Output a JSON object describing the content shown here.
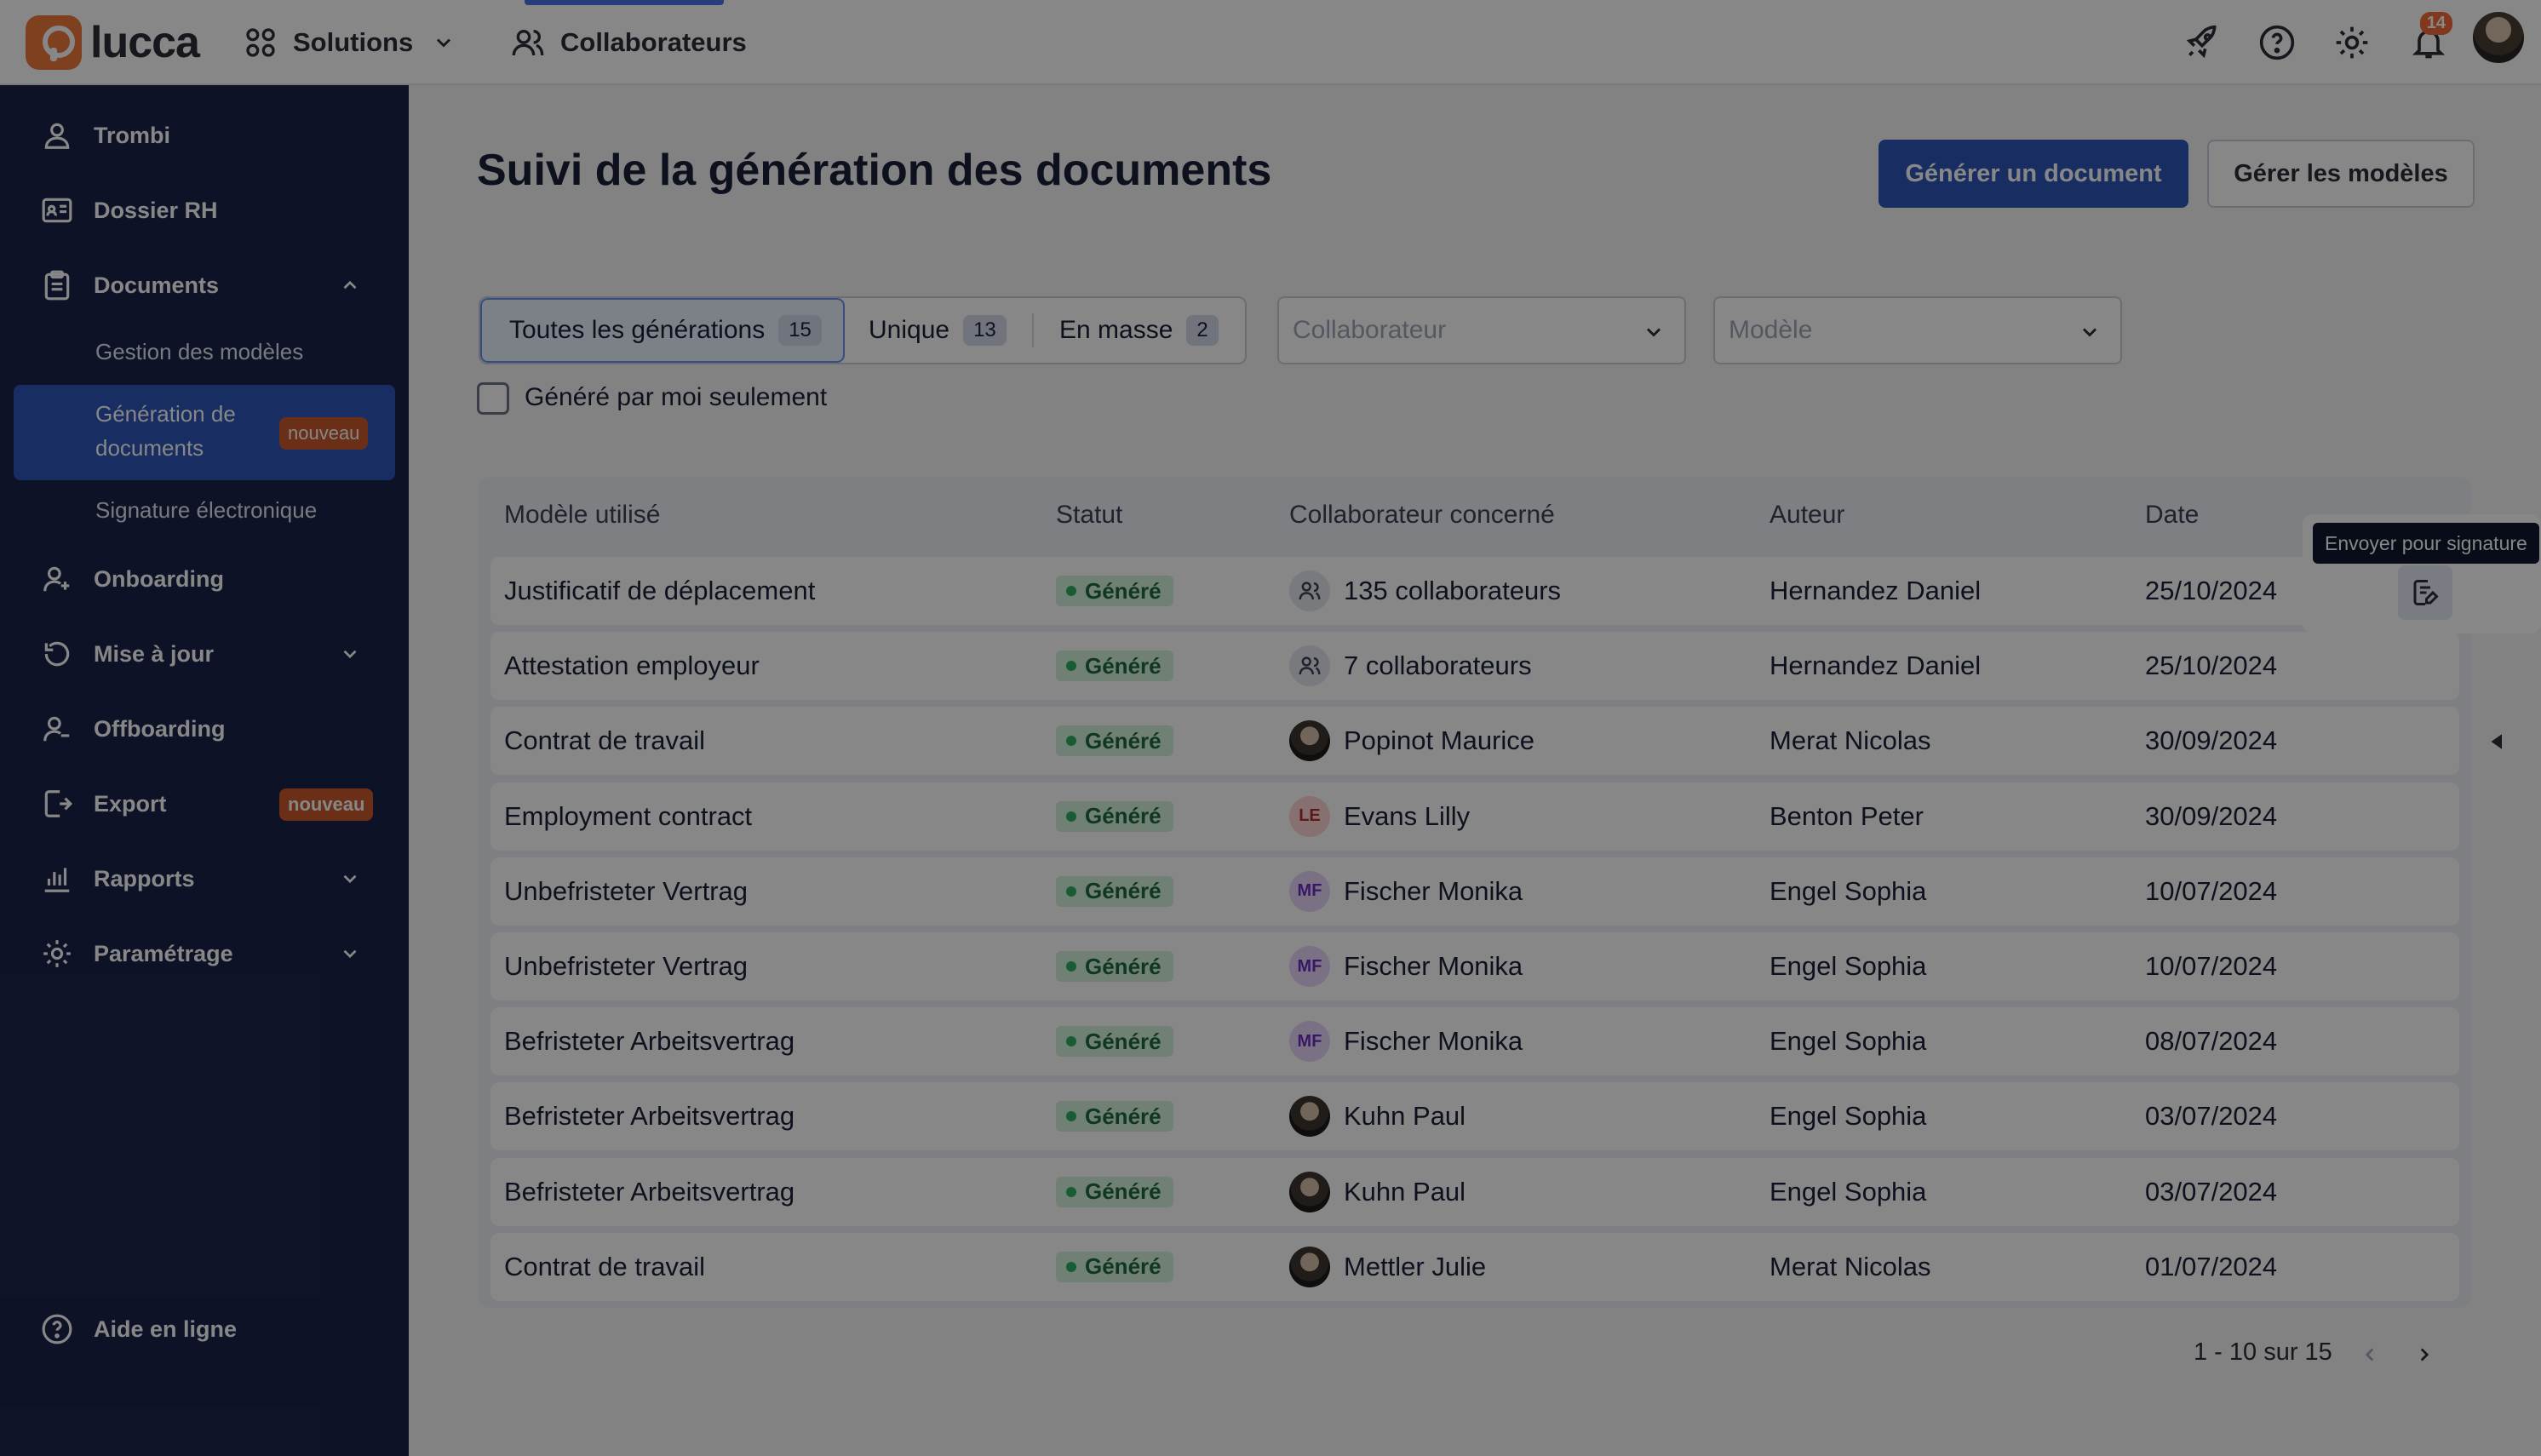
{
  "brand": {
    "name": "lucca",
    "accent": "#f07a3c",
    "primary": "#2f55b8",
    "sidebar_bg": "#1a2349"
  },
  "topbar": {
    "solutions_label": "Solutions",
    "collaborateurs_label": "Collaborateurs",
    "notifications_count": "14",
    "icons": [
      "rocket-icon",
      "help-icon",
      "gear-icon",
      "bell-icon"
    ]
  },
  "sidebar": {
    "items": [
      {
        "label": "Trombi",
        "icon": "person-icon"
      },
      {
        "label": "Dossier RH",
        "icon": "id-card-icon"
      },
      {
        "label": "Documents",
        "icon": "clipboard-icon",
        "expanded": true
      },
      {
        "label": "Onboarding",
        "icon": "person-add-icon"
      },
      {
        "label": "Mise à jour",
        "icon": "refresh-icon"
      },
      {
        "label": "Offboarding",
        "icon": "person-remove-icon"
      },
      {
        "label": "Export",
        "icon": "export-icon",
        "badge": "nouveau"
      },
      {
        "label": "Rapports",
        "icon": "bar-chart-icon"
      },
      {
        "label": "Paramétrage",
        "icon": "gear-icon"
      }
    ],
    "documents_sub": [
      {
        "label": "Gestion des modèles"
      },
      {
        "label": "Génération de documents",
        "badge": "nouveau",
        "active": true
      },
      {
        "label": "Signature électronique"
      }
    ],
    "footer_label": "Aide en ligne"
  },
  "page": {
    "title": "Suivi de la génération des documents",
    "primary_button": "Générer un document",
    "secondary_button": "Gérer les modèles"
  },
  "filters": {
    "segments": [
      {
        "label": "Toutes les générations",
        "count": "15",
        "active": true
      },
      {
        "label": "Unique",
        "count": "13"
      },
      {
        "label": "En masse",
        "count": "2"
      }
    ],
    "collaborateur_placeholder": "Collaborateur",
    "modele_placeholder": "Modèle",
    "checkbox_label": "Généré par moi seulement",
    "checkbox_checked": false
  },
  "table": {
    "columns": [
      "Modèle utilisé",
      "Statut",
      "Collaborateur concerné",
      "Auteur",
      "Date"
    ],
    "rows": [
      {
        "modele": "Justificatif de déplacement",
        "statut": "Généré",
        "collaborateur": "135 collaborateurs",
        "avatar": "group",
        "auteur": "Hernandez Daniel",
        "date": "25/10/2024"
      },
      {
        "modele": "Attestation employeur",
        "statut": "Généré",
        "collaborateur": "7 collaborateurs",
        "avatar": "group",
        "auteur": "Hernandez Daniel",
        "date": "25/10/2024"
      },
      {
        "modele": "Contrat de travail",
        "statut": "Généré",
        "collaborateur": "Popinot Maurice",
        "avatar": "photo",
        "auteur": "Merat Nicolas",
        "date": "30/09/2024"
      },
      {
        "modele": "Employment contract",
        "statut": "Généré",
        "collaborateur": "Evans Lilly",
        "avatar": "LE",
        "auteur": "Benton Peter",
        "date": "30/09/2024"
      },
      {
        "modele": "Unbefristeter Vertrag",
        "statut": "Généré",
        "collaborateur": "Fischer Monika",
        "avatar": "MF",
        "auteur": "Engel Sophia",
        "date": "10/07/2024"
      },
      {
        "modele": "Unbefristeter Vertrag",
        "statut": "Généré",
        "collaborateur": "Fischer Monika",
        "avatar": "MF",
        "auteur": "Engel Sophia",
        "date": "10/07/2024"
      },
      {
        "modele": "Befristeter Arbeitsvertrag",
        "statut": "Généré",
        "collaborateur": "Fischer Monika",
        "avatar": "MF",
        "auteur": "Engel Sophia",
        "date": "08/07/2024"
      },
      {
        "modele": "Befristeter Arbeitsvertrag",
        "statut": "Généré",
        "collaborateur": "Kuhn Paul",
        "avatar": "photo",
        "auteur": "Engel Sophia",
        "date": "03/07/2024"
      },
      {
        "modele": "Befristeter Arbeitsvertrag",
        "statut": "Généré",
        "collaborateur": "Kuhn Paul",
        "avatar": "photo",
        "auteur": "Engel Sophia",
        "date": "03/07/2024"
      },
      {
        "modele": "Contrat de travail",
        "statut": "Généré",
        "collaborateur": "Mettler Julie",
        "avatar": "photo",
        "auteur": "Merat Nicolas",
        "date": "01/07/2024"
      }
    ],
    "row_action_tooltip": "Envoyer pour signature"
  },
  "pagination": {
    "label": "1 - 10 sur 15"
  }
}
